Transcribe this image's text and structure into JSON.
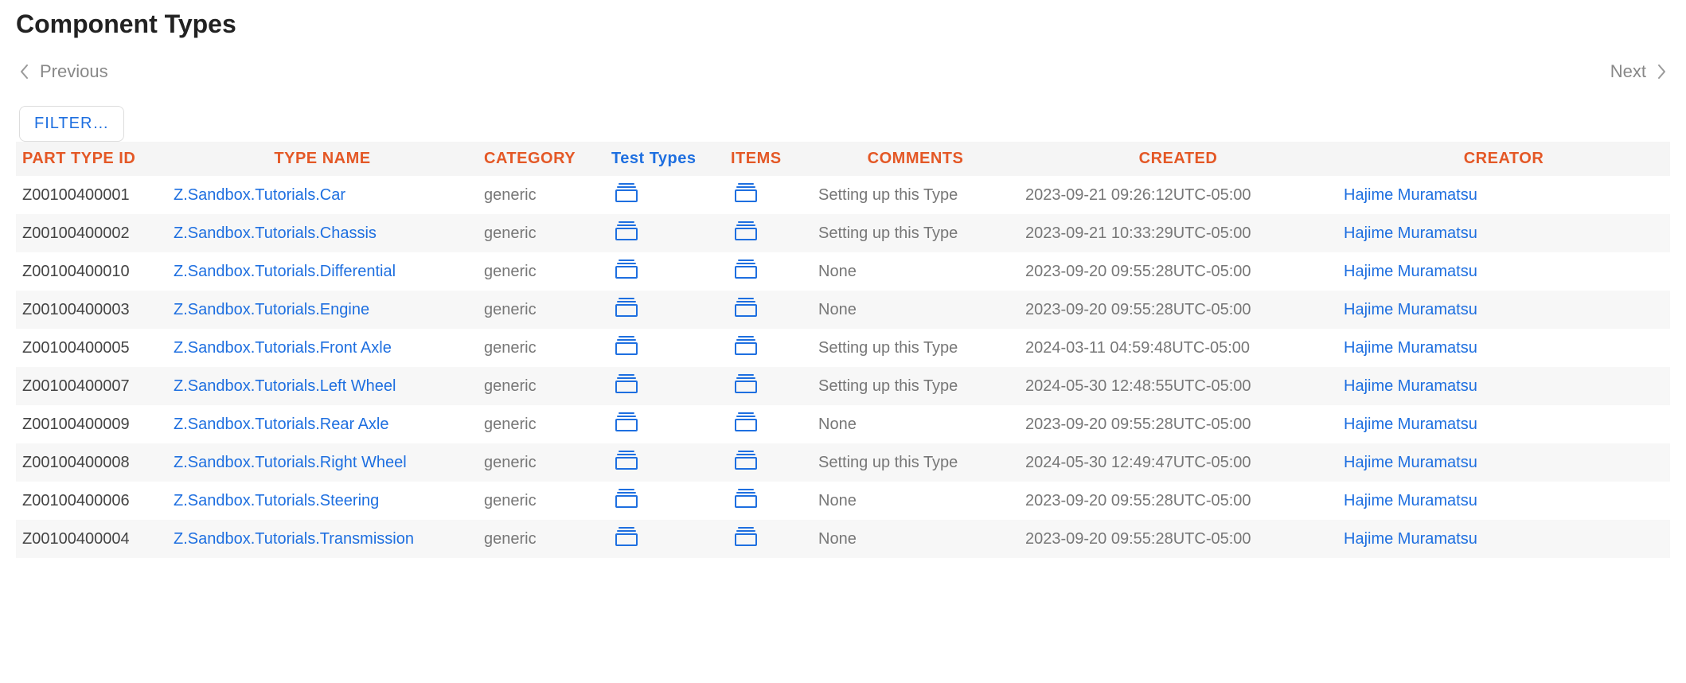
{
  "page": {
    "title": "Component Types"
  },
  "pagination": {
    "previous": "Previous",
    "next": "Next"
  },
  "filter": {
    "label": "FILTER…"
  },
  "table": {
    "headers": {
      "part_type_id": "PART TYPE ID",
      "type_name": "TYPE NAME",
      "category": "CATEGORY",
      "test_types": "Test Types",
      "items": "ITEMS",
      "comments": "COMMENTS",
      "created": "CREATED",
      "creator": "CREATOR"
    },
    "rows": [
      {
        "id": "Z00100400001",
        "name": "Z.Sandbox.Tutorials.Car",
        "category": "generic",
        "comments": "Setting up this Type",
        "created": "2023-09-21 09:26:12UTC-05:00",
        "creator": "Hajime Muramatsu"
      },
      {
        "id": "Z00100400002",
        "name": "Z.Sandbox.Tutorials.Chassis",
        "category": "generic",
        "comments": "Setting up this Type",
        "created": "2023-09-21 10:33:29UTC-05:00",
        "creator": "Hajime Muramatsu"
      },
      {
        "id": "Z00100400010",
        "name": "Z.Sandbox.Tutorials.Differential",
        "category": "generic",
        "comments": "None",
        "created": "2023-09-20 09:55:28UTC-05:00",
        "creator": "Hajime Muramatsu"
      },
      {
        "id": "Z00100400003",
        "name": "Z.Sandbox.Tutorials.Engine",
        "category": "generic",
        "comments": "None",
        "created": "2023-09-20 09:55:28UTC-05:00",
        "creator": "Hajime Muramatsu"
      },
      {
        "id": "Z00100400005",
        "name": "Z.Sandbox.Tutorials.Front Axle",
        "category": "generic",
        "comments": "Setting up this Type",
        "created": "2024-03-11 04:59:48UTC-05:00",
        "creator": "Hajime Muramatsu"
      },
      {
        "id": "Z00100400007",
        "name": "Z.Sandbox.Tutorials.Left Wheel",
        "category": "generic",
        "comments": "Setting up this Type",
        "created": "2024-05-30 12:48:55UTC-05:00",
        "creator": "Hajime Muramatsu"
      },
      {
        "id": "Z00100400009",
        "name": "Z.Sandbox.Tutorials.Rear Axle",
        "category": "generic",
        "comments": "None",
        "created": "2023-09-20 09:55:28UTC-05:00",
        "creator": "Hajime Muramatsu"
      },
      {
        "id": "Z00100400008",
        "name": "Z.Sandbox.Tutorials.Right Wheel",
        "category": "generic",
        "comments": "Setting up this Type",
        "created": "2024-05-30 12:49:47UTC-05:00",
        "creator": "Hajime Muramatsu"
      },
      {
        "id": "Z00100400006",
        "name": "Z.Sandbox.Tutorials.Steering",
        "category": "generic",
        "comments": "None",
        "created": "2023-09-20 09:55:28UTC-05:00",
        "creator": "Hajime Muramatsu"
      },
      {
        "id": "Z00100400004",
        "name": "Z.Sandbox.Tutorials.Transmission",
        "category": "generic",
        "comments": "None",
        "created": "2023-09-20 09:55:28UTC-05:00",
        "creator": "Hajime Muramatsu"
      }
    ]
  }
}
